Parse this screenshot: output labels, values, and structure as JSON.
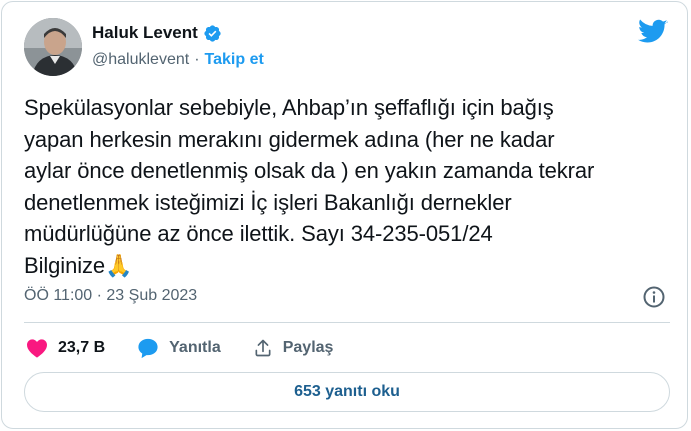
{
  "author": {
    "name": "Haluk Levent",
    "handle": "@haluklevent",
    "separator": "·",
    "follow_label": "Takip et"
  },
  "tweet": {
    "text": "Spekülasyonlar sebebiyle, Ahbap’ın şeffaflığı için bağış\nyapan herkesin merakını gidermek adına (her ne kadar\naylar önce denetlenmiş olsak da ) en yakın zamanda tekrar\ndenetlenmek isteğimizi İç işleri Bakanlığı dernekler\nmüdürlüğüne az önce ilettik. Sayı 34-235-051/24\nBilginize",
    "emoji": "🙏",
    "timestamp": "ÖÖ 11:00 · 23 Şub 2023"
  },
  "actions": {
    "like_count": "23,7 B",
    "reply_label": "Yanıtla",
    "share_label": "Paylaş"
  },
  "read_replies_label": "653 yanıtı oku",
  "colors": {
    "accent": "#1d9bf0",
    "like": "#f91880",
    "muted": "#536471",
    "border": "#cfd9de"
  },
  "icons": {
    "brand": "twitter-bird-icon",
    "verified": "verified-badge-icon",
    "info": "info-icon",
    "like": "heart-icon",
    "reply": "speech-bubble-icon",
    "share": "share-upload-icon"
  }
}
